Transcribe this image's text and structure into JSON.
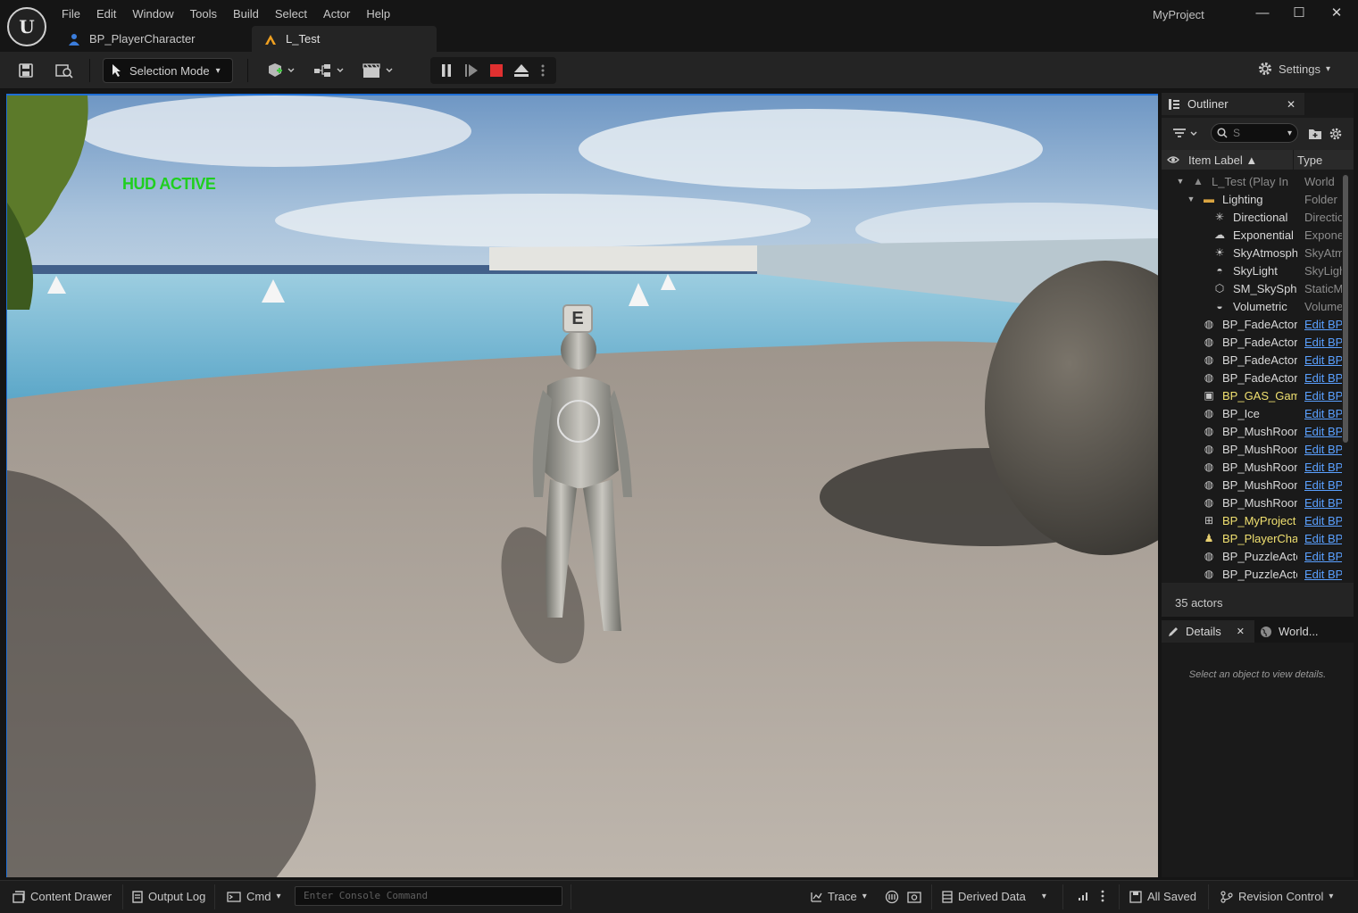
{
  "app": {
    "logo_text": "U",
    "project_name": "MyProject",
    "menu": [
      "File",
      "Edit",
      "Window",
      "Tools",
      "Build",
      "Select",
      "Actor",
      "Help"
    ],
    "window_controls": {
      "minimize": "—",
      "maximize": "☐",
      "close": "✕"
    }
  },
  "tabs": [
    {
      "label": "BP_PlayerCharacter",
      "icon": "person-icon",
      "active": false
    },
    {
      "label": "L_Test",
      "icon": "level-icon",
      "active": true
    }
  ],
  "toolbar": {
    "selection_mode": "Selection Mode",
    "settings": "Settings"
  },
  "viewport": {
    "hud_text": "HUD ACTIVE",
    "interact_key": "E"
  },
  "outliner": {
    "title": "Outliner",
    "search_placeholder": "S",
    "col_label": "Item Label ▲",
    "col_type": "Type",
    "rows": [
      {
        "label": "L_Test (Play In",
        "type": "World",
        "indent": 2,
        "icon": "level-icon",
        "link": false,
        "dim": true
      },
      {
        "label": "Lighting",
        "type": "Folder",
        "indent": 3,
        "icon": "folder-icon",
        "link": false
      },
      {
        "label": "Directional",
        "type": "Directional",
        "indent": 4,
        "icon": "directional-light-icon",
        "link": false
      },
      {
        "label": "Exponential",
        "type": "Exponential",
        "indent": 4,
        "icon": "fog-icon",
        "link": false
      },
      {
        "label": "SkyAtmosphere",
        "type": "SkyAtmosphere",
        "indent": 4,
        "icon": "sky-atmosphere-icon",
        "link": false
      },
      {
        "label": "SkyLight",
        "type": "SkyLight",
        "indent": 4,
        "icon": "skylight-icon",
        "link": false
      },
      {
        "label": "SM_SkySphere",
        "type": "StaticMesh",
        "indent": 4,
        "icon": "static-mesh-icon",
        "link": false
      },
      {
        "label": "Volumetric",
        "type": "Volumetric",
        "indent": 4,
        "icon": "volumetric-cloud-icon",
        "link": false
      },
      {
        "label": "BP_FadeActor",
        "type": "Edit BP",
        "indent": 3,
        "icon": "actor-icon",
        "link": true
      },
      {
        "label": "BP_FadeActor",
        "type": "Edit BP",
        "indent": 3,
        "icon": "actor-icon",
        "link": true
      },
      {
        "label": "BP_FadeActor",
        "type": "Edit BP",
        "indent": 3,
        "icon": "actor-icon",
        "link": true
      },
      {
        "label": "BP_FadeActor",
        "type": "Edit BP",
        "indent": 3,
        "icon": "actor-icon",
        "link": true
      },
      {
        "label": "BP_GAS_GameMode",
        "type": "Edit BP",
        "indent": 3,
        "icon": "gamemode-icon",
        "link": true,
        "highlight": true
      },
      {
        "label": "BP_Ice",
        "type": "Edit BP",
        "indent": 3,
        "icon": "actor-icon",
        "link": true
      },
      {
        "label": "BP_MushRoom",
        "type": "Edit BP",
        "indent": 3,
        "icon": "actor-icon",
        "link": true
      },
      {
        "label": "BP_MushRoom",
        "type": "Edit BP",
        "indent": 3,
        "icon": "actor-icon",
        "link": true
      },
      {
        "label": "BP_MushRoom",
        "type": "Edit BP",
        "indent": 3,
        "icon": "actor-icon",
        "link": true
      },
      {
        "label": "BP_MushRoom",
        "type": "Edit BP",
        "indent": 3,
        "icon": "actor-icon",
        "link": true
      },
      {
        "label": "BP_MushRoom",
        "type": "Edit BP",
        "indent": 3,
        "icon": "actor-icon",
        "link": true
      },
      {
        "label": "BP_MyProject",
        "type": "Edit BP",
        "indent": 3,
        "icon": "hud-icon",
        "link": true,
        "highlight": true
      },
      {
        "label": "BP_PlayerCharacter",
        "type": "Edit BP",
        "indent": 3,
        "icon": "pawn-icon",
        "link": true,
        "highlight": true
      },
      {
        "label": "BP_PuzzleActor",
        "type": "Edit BP",
        "indent": 3,
        "icon": "actor-icon",
        "link": true
      },
      {
        "label": "BP_PuzzleActor",
        "type": "Edit BP",
        "indent": 3,
        "icon": "actor-icon",
        "link": true
      }
    ],
    "actor_count": "35 actors"
  },
  "details": {
    "tab_label": "Details",
    "world_tab_label": "World...",
    "empty_message": "Select an object to view details."
  },
  "statusbar": {
    "content_drawer": "Content Drawer",
    "output_log": "Output Log",
    "cmd": "Cmd",
    "console_placeholder": "Enter Console Command",
    "trace": "Trace",
    "derived_data": "Derived Data",
    "all_saved": "All Saved",
    "revision_control": "Revision Control"
  },
  "colors": {
    "accent": "#1f6fd6",
    "hud_green": "#1fcf1f",
    "link": "#5aa0ff",
    "stop_red": "#e03030"
  }
}
